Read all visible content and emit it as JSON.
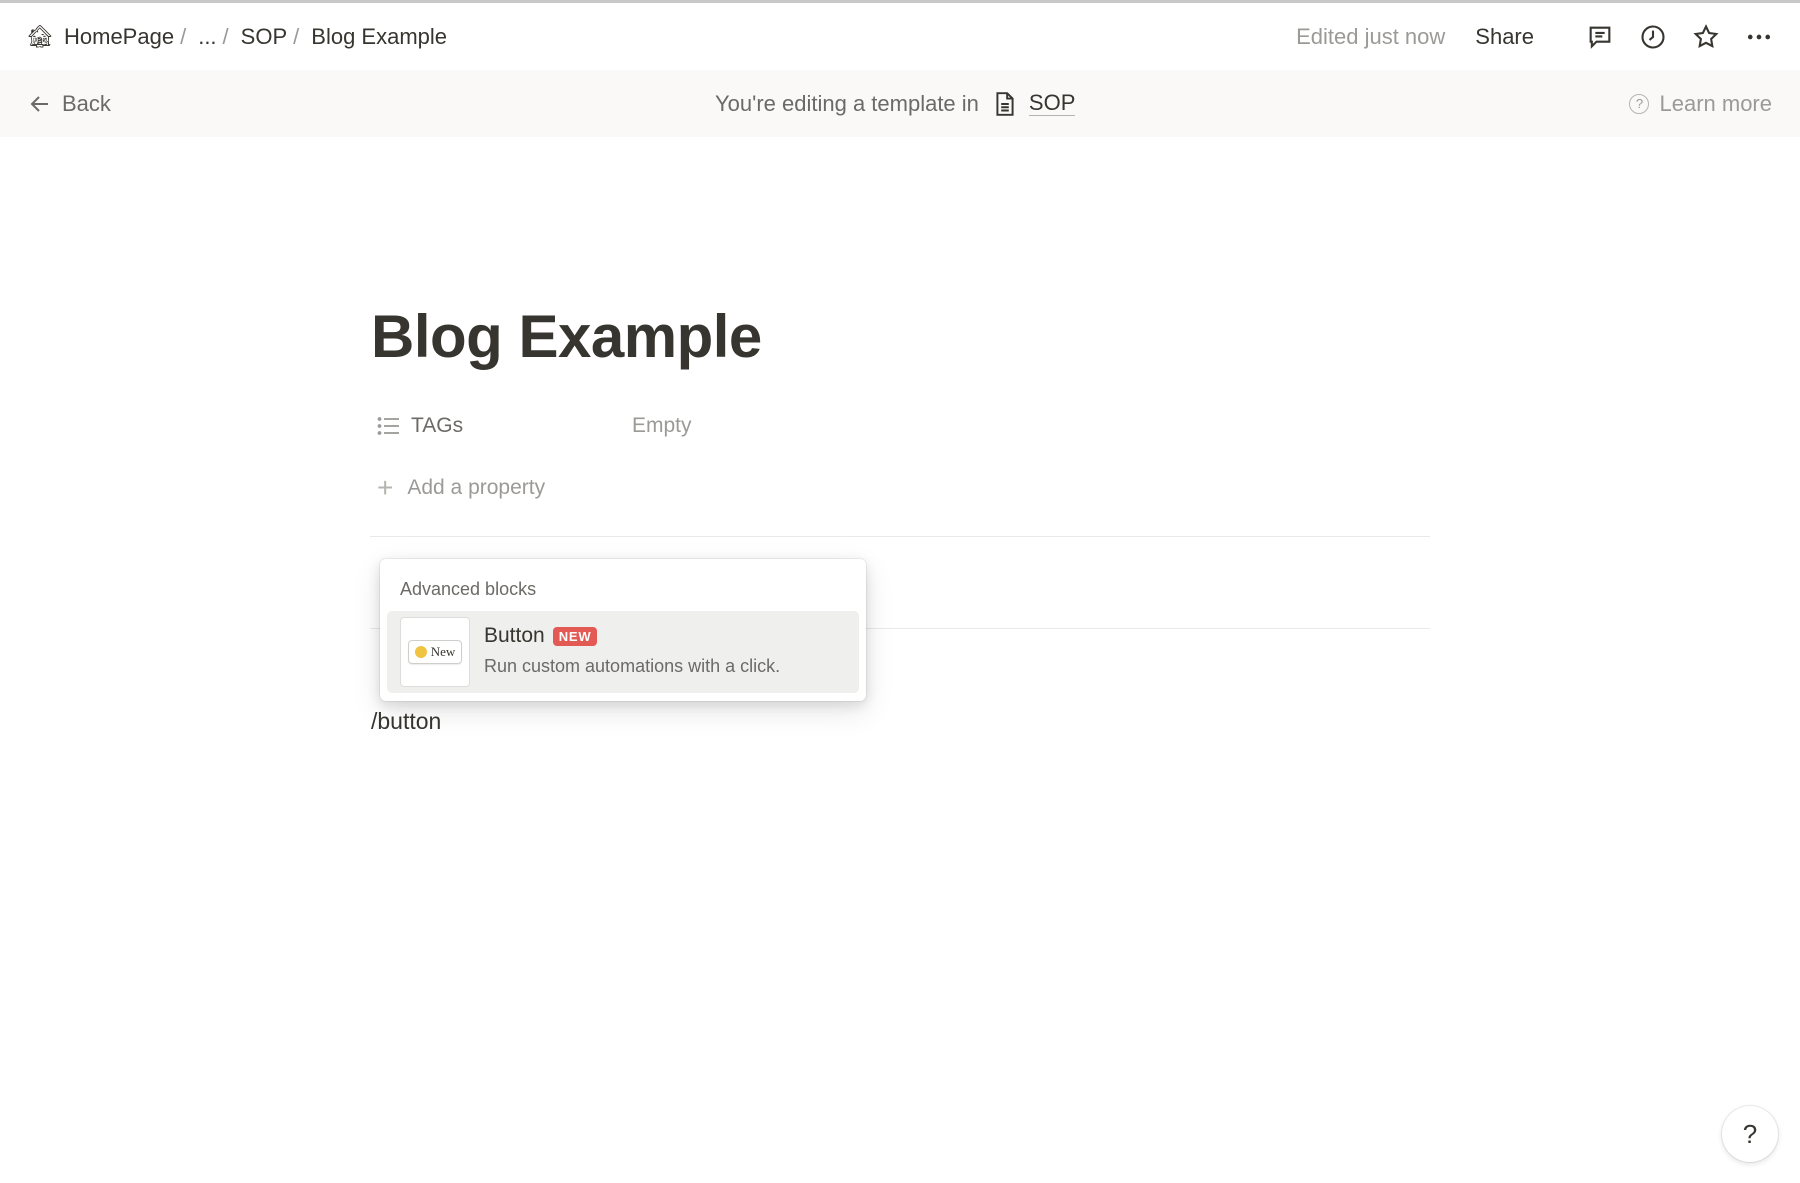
{
  "topbar": {
    "breadcrumb": [
      {
        "label": "HomePage"
      },
      {
        "label": "..."
      },
      {
        "label": "SOP"
      },
      {
        "label": "Blog Example"
      }
    ],
    "separator": "/",
    "home_icon": "🏚",
    "edited_status": "Edited just now",
    "share_label": "Share",
    "icons": [
      "comment-icon",
      "clock-icon",
      "star-icon",
      "more-icon"
    ]
  },
  "banner": {
    "back_label": "Back",
    "text": "You're editing a template in",
    "database_name": "SOP",
    "learn_more_label": "Learn more"
  },
  "page": {
    "title": "Blog Example",
    "properties": [
      {
        "name": "TAGs",
        "value": "Empty",
        "icon": "list-icon"
      }
    ],
    "add_property_label": "Add a property",
    "slash_command": "/button"
  },
  "popup": {
    "section_label": "Advanced blocks",
    "items": [
      {
        "title": "Button",
        "badge": "NEW",
        "description": "Run custom automations with a click.",
        "thumbnail_label": "New"
      }
    ]
  },
  "help_label": "?",
  "colors": {
    "text": "#37352f",
    "muted": "#9b9a97",
    "banner_bg": "#fbf9f7",
    "badge_bg": "#e25a53",
    "highlight_bg": "#efefee"
  }
}
